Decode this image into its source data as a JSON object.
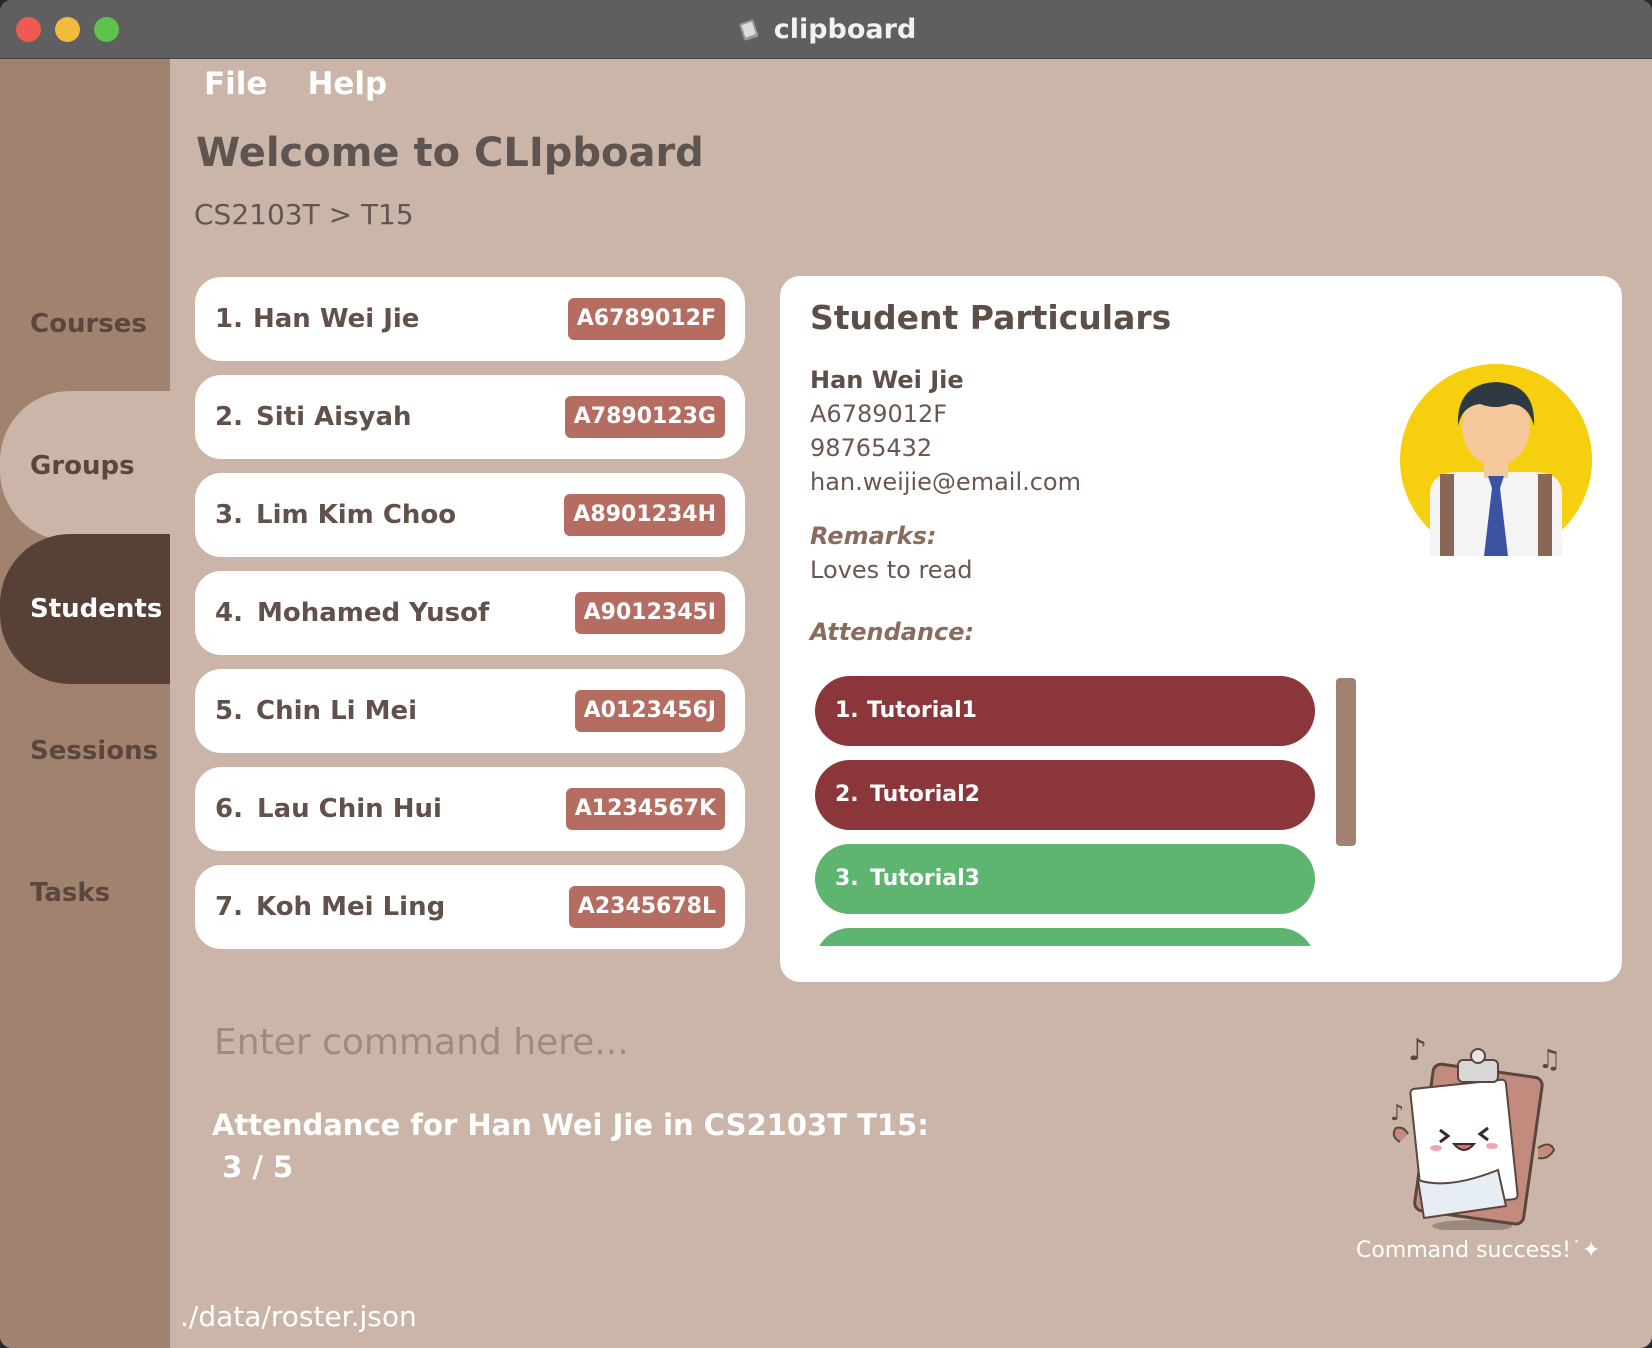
{
  "window": {
    "title": "clipboard"
  },
  "menu": {
    "file": "File",
    "help": "Help"
  },
  "sidebar": {
    "items": [
      "Courses",
      "Groups",
      "Students",
      "Sessions",
      "Tasks"
    ],
    "active": "Students"
  },
  "header": {
    "welcome": "Welcome to CLIpboard",
    "breadcrumb": "CS2103T > T15"
  },
  "students": [
    {
      "index": "1.",
      "name": "Han Wei Jie",
      "id": "A6789012F"
    },
    {
      "index": "2.",
      "name": "Siti Aisyah",
      "id": "A7890123G"
    },
    {
      "index": "3.",
      "name": "Lim Kim Choo",
      "id": "A8901234H"
    },
    {
      "index": "4.",
      "name": "Mohamed Yusof",
      "id": "A9012345I"
    },
    {
      "index": "5.",
      "name": "Chin Li Mei",
      "id": "A0123456J"
    },
    {
      "index": "6.",
      "name": "Lau Chin Hui",
      "id": "A1234567K"
    },
    {
      "index": "7.",
      "name": "Koh Mei Ling",
      "id": "A2345678L"
    }
  ],
  "particulars": {
    "title": "Student Particulars",
    "name": "Han Wei Jie",
    "student_id": "A6789012F",
    "phone": "98765432",
    "email": "han.weijie@email.com",
    "remarks_label": "Remarks:",
    "remarks": "Loves to read",
    "attendance_label": "Attendance:",
    "attendance": [
      {
        "index": "1.",
        "label": "Tutorial1",
        "status": "absent"
      },
      {
        "index": "2.",
        "label": "Tutorial2",
        "status": "absent"
      },
      {
        "index": "3.",
        "label": "Tutorial3",
        "status": "present"
      },
      {
        "index": "",
        "label": "",
        "status": "present"
      }
    ]
  },
  "command": {
    "placeholder": "Enter command here...",
    "result_line1": "Attendance for Han Wei Jie in CS2103T T15:",
    "result_line2": " 3 / 5",
    "success": "Command success!",
    "success_deco": "˙✦"
  },
  "status_bar": {
    "path": "./data/roster.json"
  },
  "colors": {
    "background": "#cbb5a8",
    "sidebar": "#a0826e",
    "active_tab": "#574137",
    "badge": "#b56d61",
    "absent": "#8a363a",
    "present": "#5db56f"
  }
}
